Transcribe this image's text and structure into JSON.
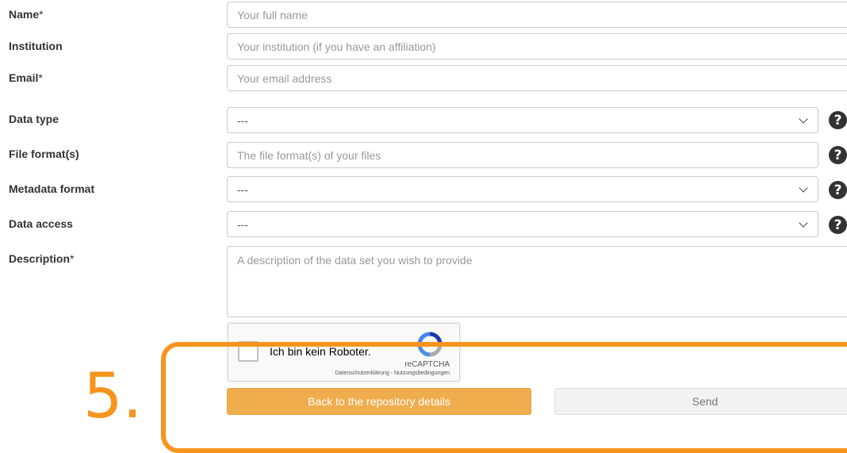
{
  "form": {
    "name": {
      "label": "Name",
      "required": "*",
      "placeholder": "Your full name"
    },
    "institution": {
      "label": "Institution",
      "placeholder": "Your institution (if you have an affiliation)"
    },
    "email": {
      "label": "Email",
      "required": "*",
      "placeholder": "Your email address"
    },
    "data_type": {
      "label": "Data type",
      "value": "---"
    },
    "file_formats": {
      "label": "File format(s)",
      "placeholder": "The file format(s) of your files"
    },
    "metadata_format": {
      "label": "Metadata format",
      "value": "---"
    },
    "data_access": {
      "label": "Data access",
      "value": "---"
    },
    "description": {
      "label": "Description",
      "required": "*",
      "placeholder": "A description of the data set you wish to provide"
    },
    "help_glyph": "?"
  },
  "captcha": {
    "label": "Ich bin kein Roboter.",
    "brand": "reCAPTCHA",
    "links": "Datenschutzerklärung - Nutzungsbedingungen"
  },
  "buttons": {
    "back": "Back to the repository details",
    "send": "Send"
  },
  "annotation": {
    "step_number": "5.",
    "color": "#f7941d"
  },
  "colors": {
    "back_button": "#f0ad4e",
    "help_icon": "#333333"
  }
}
